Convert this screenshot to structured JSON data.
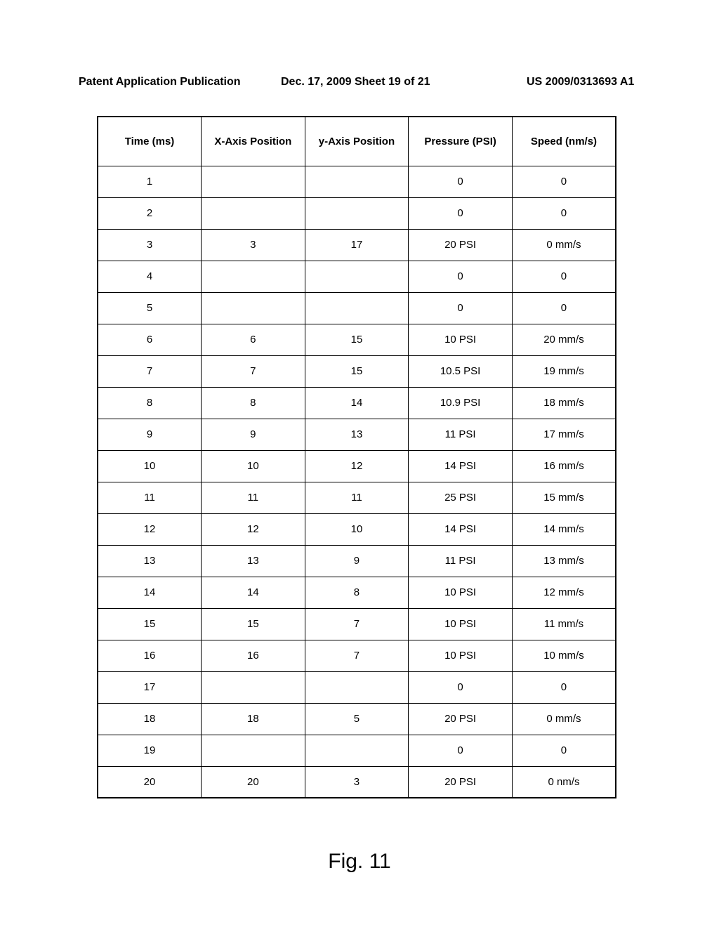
{
  "header": {
    "left": "Patent Application Publication",
    "center": "Dec. 17, 2009  Sheet 19 of 21",
    "right": "US 2009/0313693 A1"
  },
  "table": {
    "headers": {
      "time": "Time (ms)",
      "x": "X-Axis Position",
      "y": "y-Axis Position",
      "pressure": "Pressure (PSI)",
      "speed": "Speed (nm/s)"
    },
    "rows": [
      {
        "time": "1",
        "x": "",
        "y": "",
        "pressure": "0",
        "speed": "0"
      },
      {
        "time": "2",
        "x": "",
        "y": "",
        "pressure": "0",
        "speed": "0"
      },
      {
        "time": "3",
        "x": "3",
        "y": "17",
        "pressure": "20 PSI",
        "speed": "0  mm/s"
      },
      {
        "time": "4",
        "x": "",
        "y": "",
        "pressure": "0",
        "speed": "0"
      },
      {
        "time": "5",
        "x": "",
        "y": "",
        "pressure": "0",
        "speed": "0"
      },
      {
        "time": "6",
        "x": "6",
        "y": "15",
        "pressure": "10 PSI",
        "speed": "20 mm/s"
      },
      {
        "time": "7",
        "x": "7",
        "y": "15",
        "pressure": "10.5 PSI",
        "speed": "19 mm/s"
      },
      {
        "time": "8",
        "x": "8",
        "y": "14",
        "pressure": "10.9 PSI",
        "speed": "18 mm/s"
      },
      {
        "time": "9",
        "x": "9",
        "y": "13",
        "pressure": "11 PSI",
        "speed": "17 mm/s"
      },
      {
        "time": "10",
        "x": "10",
        "y": "12",
        "pressure": "14 PSI",
        "speed": "16 mm/s"
      },
      {
        "time": "11",
        "x": "11",
        "y": "11",
        "pressure": "25 PSI",
        "speed": "15 mm/s"
      },
      {
        "time": "12",
        "x": "12",
        "y": "10",
        "pressure": "14 PSI",
        "speed": "14 mm/s"
      },
      {
        "time": "13",
        "x": "13",
        "y": "9",
        "pressure": "11 PSI",
        "speed": "13 mm/s"
      },
      {
        "time": "14",
        "x": "14",
        "y": "8",
        "pressure": "10 PSI",
        "speed": "12 mm/s"
      },
      {
        "time": "15",
        "x": "15",
        "y": "7",
        "pressure": "10 PSI",
        "speed": "11 mm/s"
      },
      {
        "time": "16",
        "x": "16",
        "y": "7",
        "pressure": "10 PSI",
        "speed": "10 mm/s"
      },
      {
        "time": "17",
        "x": "",
        "y": "",
        "pressure": "0",
        "speed": "0"
      },
      {
        "time": "18",
        "x": "18",
        "y": "5",
        "pressure": "20 PSI",
        "speed": "0 mm/s"
      },
      {
        "time": "19",
        "x": "",
        "y": "",
        "pressure": "0",
        "speed": "0"
      },
      {
        "time": "20",
        "x": "20",
        "y": "3",
        "pressure": "20 PSI",
        "speed": "0 nm/s"
      }
    ]
  },
  "figure_label": "Fig. 11"
}
